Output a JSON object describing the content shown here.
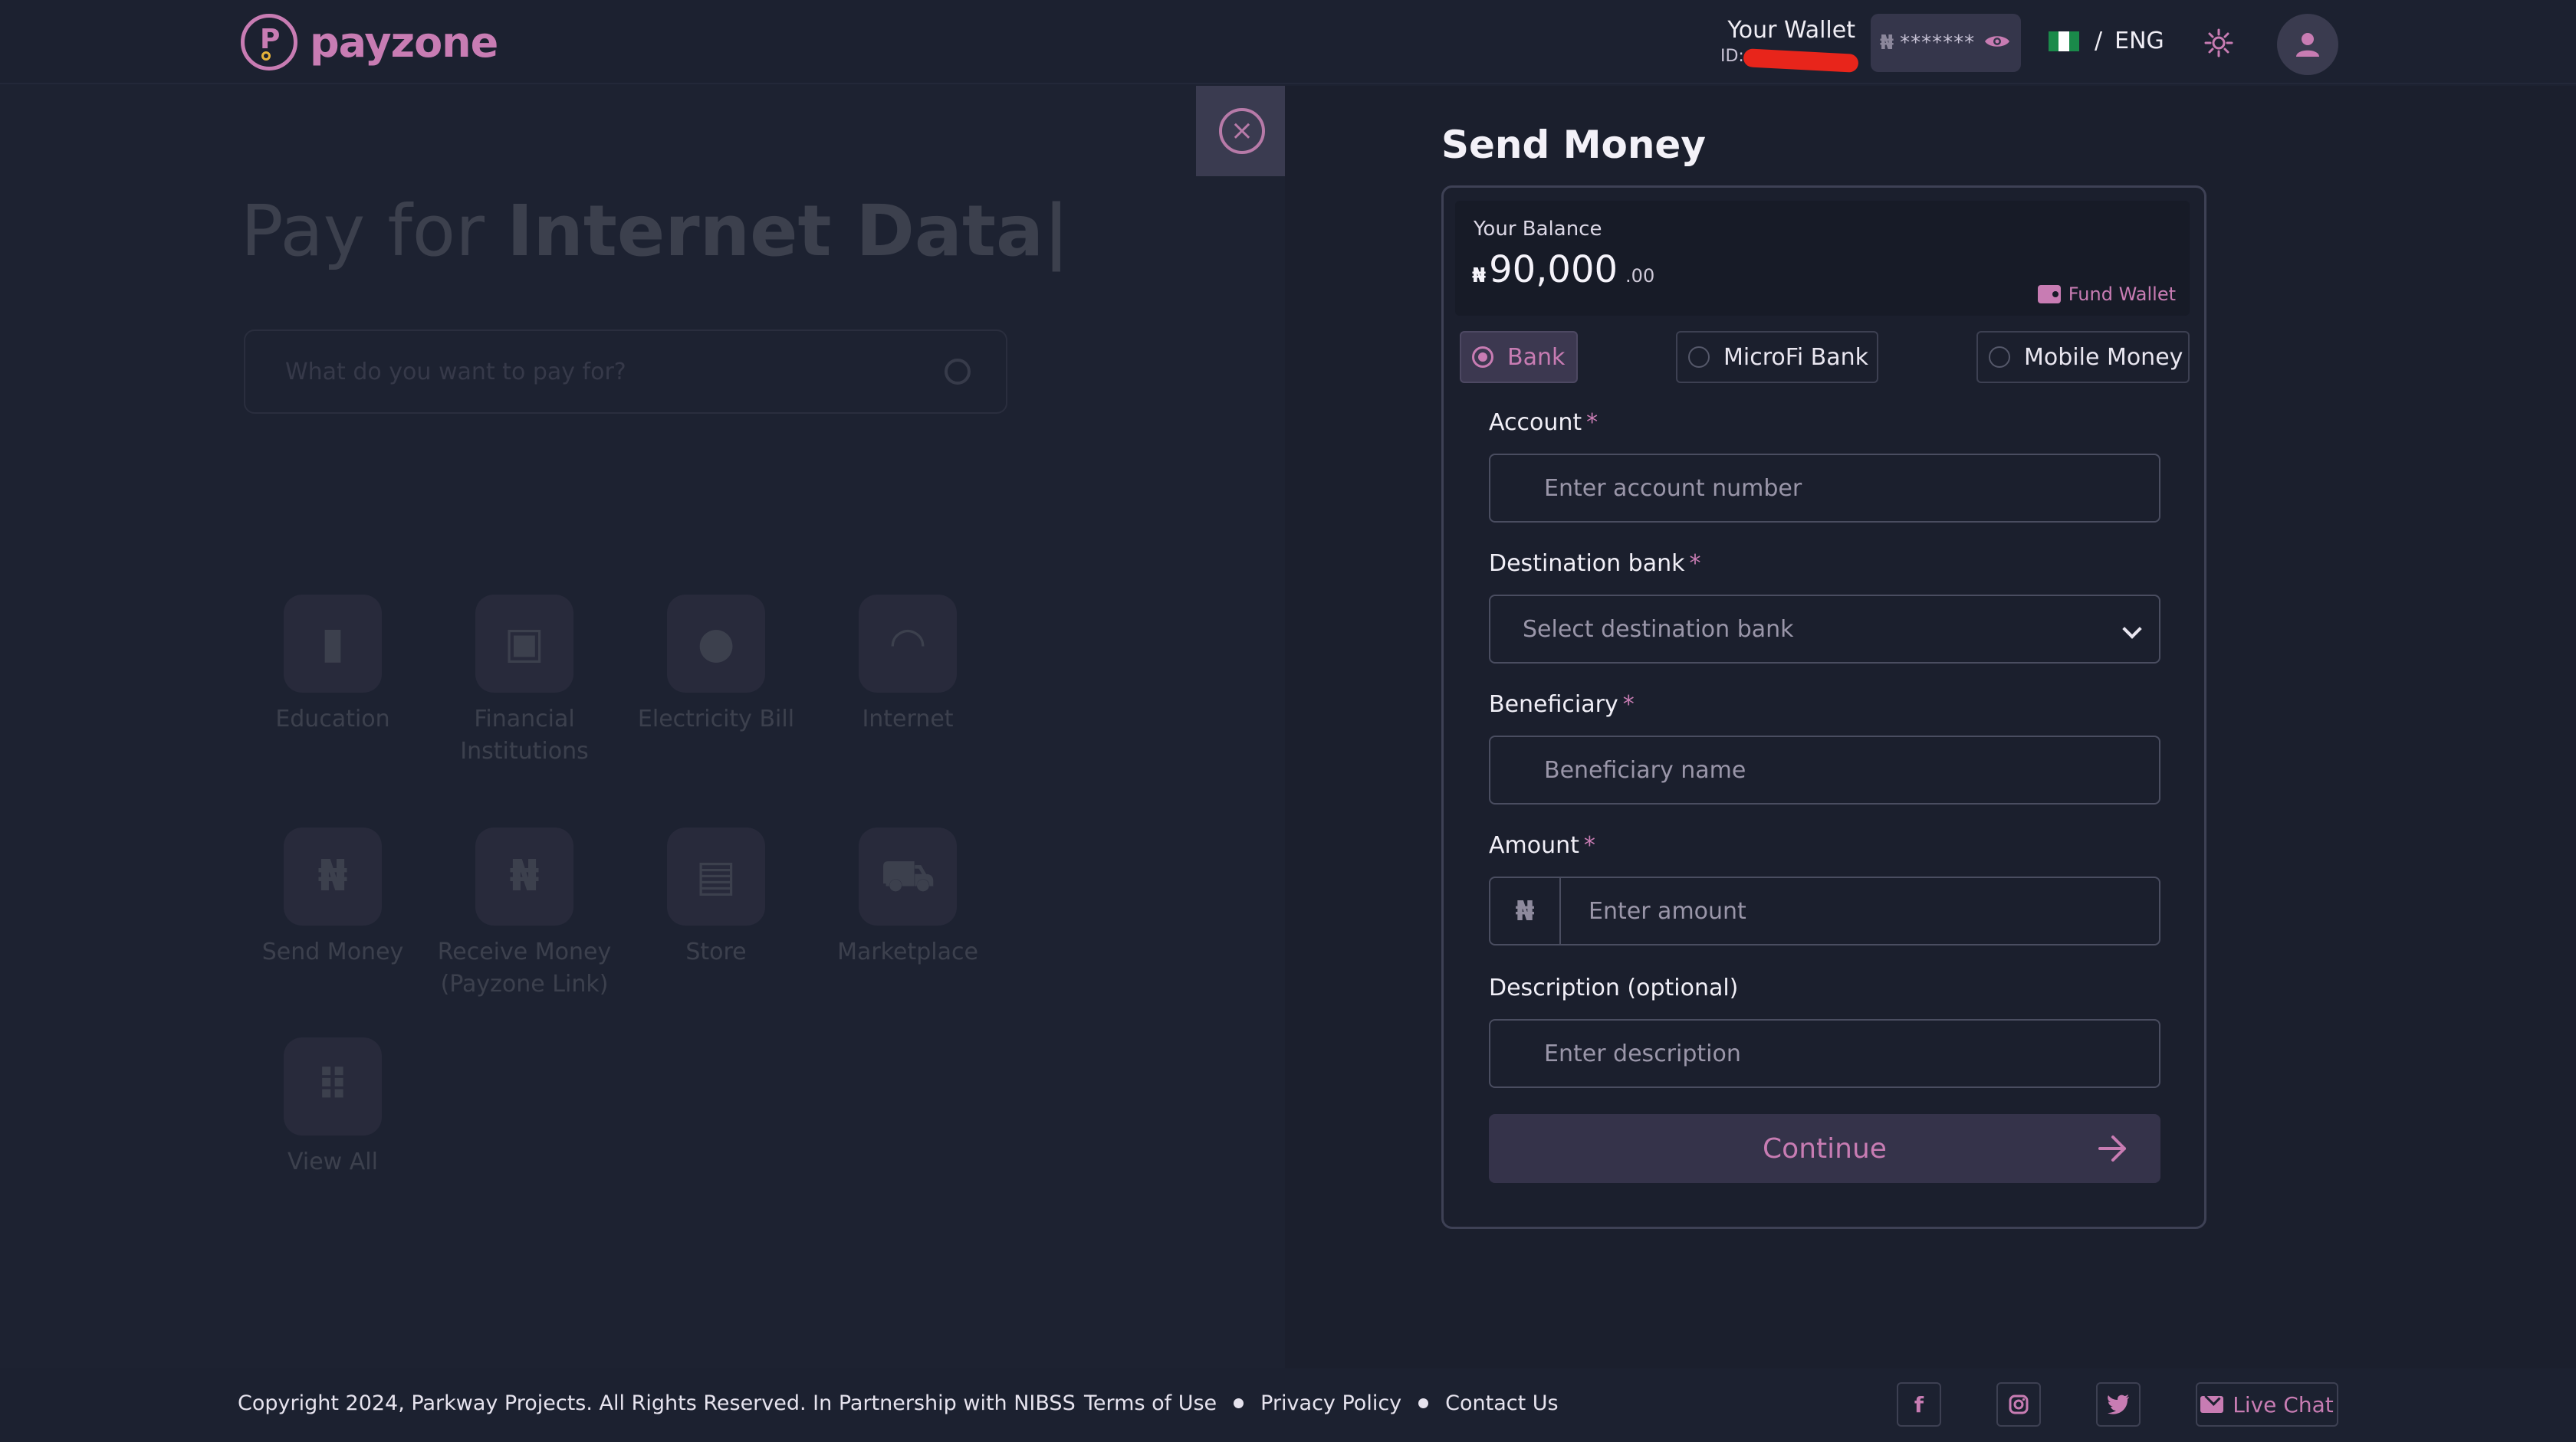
{
  "header": {
    "logo_text": "payzone",
    "wallet_title": "Your Wallet",
    "wallet_id_prefix": "ID:",
    "balance_currency": "₦",
    "balance_masked": "*******",
    "language": "ENG",
    "language_separator": "/"
  },
  "background": {
    "hero_prefix": "Pay for ",
    "hero_highlight": "Internet Data|",
    "search_placeholder": "What do you want to pay for?",
    "services": [
      {
        "label": "Education",
        "icon": "book-icon"
      },
      {
        "label": "Financial Institutions",
        "icon": "atm-icon"
      },
      {
        "label": "Electricity Bill",
        "icon": "bulb-icon"
      },
      {
        "label": "Internet",
        "icon": "wifi-icon"
      },
      {
        "label": "Send Money",
        "icon": "naira-send-icon"
      },
      {
        "label": "Receive Money (Payzone Link)",
        "icon": "naira-receive-icon"
      },
      {
        "label": "Store",
        "icon": "store-icon"
      },
      {
        "label": "Marketplace",
        "icon": "cart-icon"
      },
      {
        "label": "View All",
        "icon": "grid-icon"
      }
    ]
  },
  "panel": {
    "title": "Send Money",
    "balance_label": "Your Balance",
    "balance_currency": "₦",
    "balance_amount": "90,000",
    "balance_decimals": ".00",
    "fund_wallet": "Fund Wallet",
    "transfer_types": [
      {
        "label": "Bank",
        "selected": true
      },
      {
        "label": "MicroFi Bank",
        "selected": false
      },
      {
        "label": "Mobile Money",
        "selected": false
      }
    ],
    "account_label": "Account",
    "account_placeholder": "Enter account number",
    "bank_label": "Destination bank",
    "bank_placeholder": "Select destination bank",
    "beneficiary_label": "Beneficiary",
    "beneficiary_placeholder": "Beneficiary name",
    "amount_label": "Amount",
    "amount_currency": "₦",
    "amount_placeholder": "Enter amount",
    "description_label": "Description (optional)",
    "description_placeholder": "Enter description",
    "required_marker": "*",
    "continue_label": "Continue"
  },
  "footer": {
    "copyright": "Copyright 2024, Parkway Projects. All Rights Reserved. In Partnership with NIBSS",
    "terms": "Terms of Use",
    "privacy": "Privacy Policy",
    "contact": "Contact Us",
    "live_chat": "Live Chat"
  },
  "colors": {
    "accent": "#c87cb3",
    "background": "#1d2231",
    "panel": "#1b1f2d"
  }
}
